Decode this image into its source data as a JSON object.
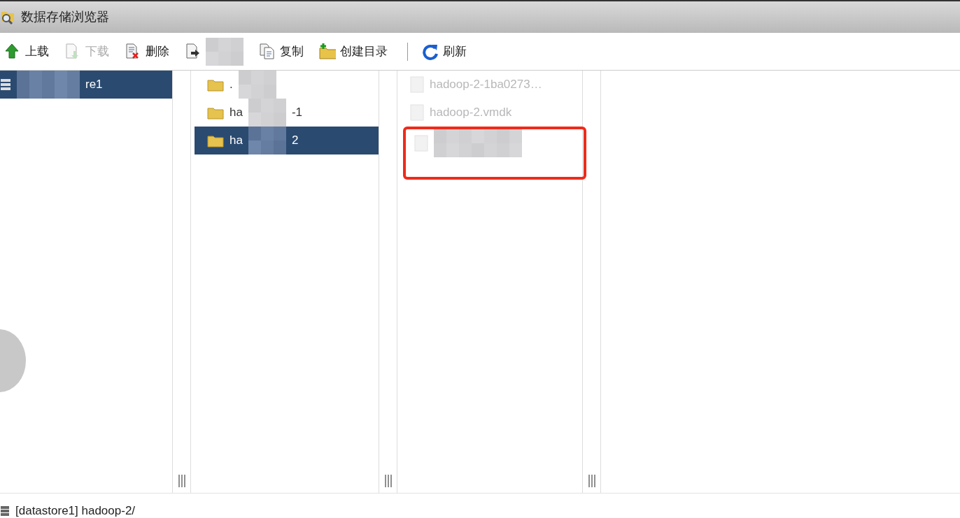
{
  "window": {
    "title": "数据存储浏览器"
  },
  "toolbar": [
    {
      "kind": "upload",
      "label": "上载",
      "disabled": false
    },
    {
      "kind": "download",
      "label": "下载",
      "disabled": true
    },
    {
      "kind": "delete",
      "label": "删除",
      "disabled": false
    },
    {
      "kind": "move",
      "redacted": true,
      "disabled": false
    },
    {
      "kind": "copy",
      "label": "复制",
      "disabled": false
    },
    {
      "kind": "newfolder",
      "label": "创建目录",
      "disabled": false
    },
    {
      "kind": "separator"
    },
    {
      "kind": "refresh",
      "label": "刷新",
      "disabled": false
    }
  ],
  "panes": [
    {
      "items": [
        {
          "kind": "datastore",
          "redacted": true,
          "tail": "re1",
          "selected": true
        }
      ]
    },
    {
      "items": [
        {
          "kind": "folder",
          "lead": ".",
          "redacted": true,
          "selected": false
        },
        {
          "kind": "folder",
          "lead": "ha",
          "redacted": true,
          "tail": "-1",
          "selected": false
        },
        {
          "kind": "folder",
          "lead": "ha",
          "redacted": true,
          "tail": "2",
          "selected": true
        }
      ]
    },
    {
      "items": [
        {
          "kind": "file",
          "lead": "hadoop-2-1ba0273…",
          "disabled": true,
          "selected": false
        },
        {
          "kind": "file",
          "lead": "hadoop-2.vmdk",
          "disabled": true,
          "selected": false
        },
        {
          "kind": "file",
          "redacted": true,
          "annotated": true,
          "selected": false
        }
      ]
    }
  ],
  "status_bar": {
    "path": "[datastore1] hadoop-2/"
  }
}
